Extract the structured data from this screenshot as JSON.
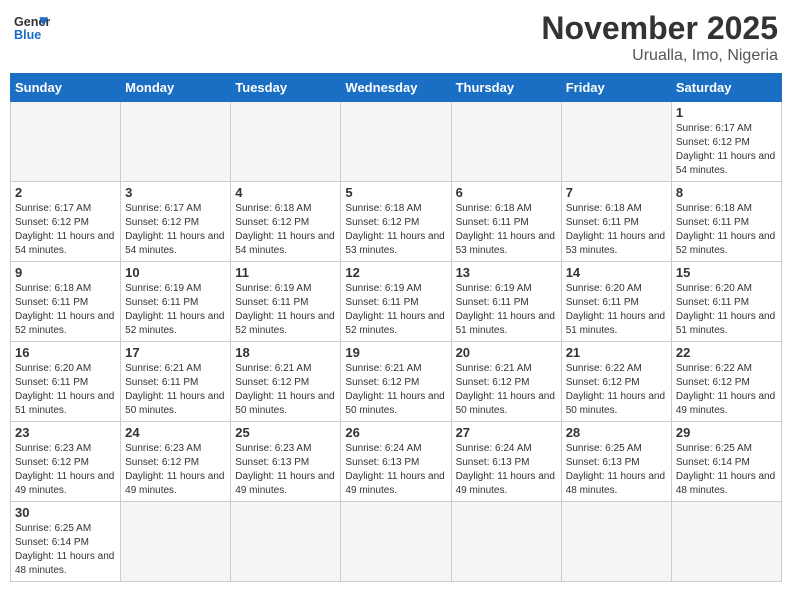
{
  "header": {
    "logo_general": "General",
    "logo_blue": "Blue",
    "month_title": "November 2025",
    "location": "Urualla, Imo, Nigeria"
  },
  "weekdays": [
    "Sunday",
    "Monday",
    "Tuesday",
    "Wednesday",
    "Thursday",
    "Friday",
    "Saturday"
  ],
  "weeks": [
    [
      {
        "day": "",
        "empty": true
      },
      {
        "day": "",
        "empty": true
      },
      {
        "day": "",
        "empty": true
      },
      {
        "day": "",
        "empty": true
      },
      {
        "day": "",
        "empty": true
      },
      {
        "day": "",
        "empty": true
      },
      {
        "day": "1",
        "sunrise": "6:17 AM",
        "sunset": "6:12 PM",
        "daylight": "11 hours and 54 minutes."
      }
    ],
    [
      {
        "day": "2",
        "sunrise": "6:17 AM",
        "sunset": "6:12 PM",
        "daylight": "11 hours and 54 minutes."
      },
      {
        "day": "3",
        "sunrise": "6:17 AM",
        "sunset": "6:12 PM",
        "daylight": "11 hours and 54 minutes."
      },
      {
        "day": "4",
        "sunrise": "6:18 AM",
        "sunset": "6:12 PM",
        "daylight": "11 hours and 54 minutes."
      },
      {
        "day": "5",
        "sunrise": "6:18 AM",
        "sunset": "6:12 PM",
        "daylight": "11 hours and 53 minutes."
      },
      {
        "day": "6",
        "sunrise": "6:18 AM",
        "sunset": "6:11 PM",
        "daylight": "11 hours and 53 minutes."
      },
      {
        "day": "7",
        "sunrise": "6:18 AM",
        "sunset": "6:11 PM",
        "daylight": "11 hours and 53 minutes."
      },
      {
        "day": "8",
        "sunrise": "6:18 AM",
        "sunset": "6:11 PM",
        "daylight": "11 hours and 52 minutes."
      }
    ],
    [
      {
        "day": "9",
        "sunrise": "6:18 AM",
        "sunset": "6:11 PM",
        "daylight": "11 hours and 52 minutes."
      },
      {
        "day": "10",
        "sunrise": "6:19 AM",
        "sunset": "6:11 PM",
        "daylight": "11 hours and 52 minutes."
      },
      {
        "day": "11",
        "sunrise": "6:19 AM",
        "sunset": "6:11 PM",
        "daylight": "11 hours and 52 minutes."
      },
      {
        "day": "12",
        "sunrise": "6:19 AM",
        "sunset": "6:11 PM",
        "daylight": "11 hours and 52 minutes."
      },
      {
        "day": "13",
        "sunrise": "6:19 AM",
        "sunset": "6:11 PM",
        "daylight": "11 hours and 51 minutes."
      },
      {
        "day": "14",
        "sunrise": "6:20 AM",
        "sunset": "6:11 PM",
        "daylight": "11 hours and 51 minutes."
      },
      {
        "day": "15",
        "sunrise": "6:20 AM",
        "sunset": "6:11 PM",
        "daylight": "11 hours and 51 minutes."
      }
    ],
    [
      {
        "day": "16",
        "sunrise": "6:20 AM",
        "sunset": "6:11 PM",
        "daylight": "11 hours and 51 minutes."
      },
      {
        "day": "17",
        "sunrise": "6:21 AM",
        "sunset": "6:11 PM",
        "daylight": "11 hours and 50 minutes."
      },
      {
        "day": "18",
        "sunrise": "6:21 AM",
        "sunset": "6:12 PM",
        "daylight": "11 hours and 50 minutes."
      },
      {
        "day": "19",
        "sunrise": "6:21 AM",
        "sunset": "6:12 PM",
        "daylight": "11 hours and 50 minutes."
      },
      {
        "day": "20",
        "sunrise": "6:21 AM",
        "sunset": "6:12 PM",
        "daylight": "11 hours and 50 minutes."
      },
      {
        "day": "21",
        "sunrise": "6:22 AM",
        "sunset": "6:12 PM",
        "daylight": "11 hours and 50 minutes."
      },
      {
        "day": "22",
        "sunrise": "6:22 AM",
        "sunset": "6:12 PM",
        "daylight": "11 hours and 49 minutes."
      }
    ],
    [
      {
        "day": "23",
        "sunrise": "6:23 AM",
        "sunset": "6:12 PM",
        "daylight": "11 hours and 49 minutes."
      },
      {
        "day": "24",
        "sunrise": "6:23 AM",
        "sunset": "6:12 PM",
        "daylight": "11 hours and 49 minutes."
      },
      {
        "day": "25",
        "sunrise": "6:23 AM",
        "sunset": "6:13 PM",
        "daylight": "11 hours and 49 minutes."
      },
      {
        "day": "26",
        "sunrise": "6:24 AM",
        "sunset": "6:13 PM",
        "daylight": "11 hours and 49 minutes."
      },
      {
        "day": "27",
        "sunrise": "6:24 AM",
        "sunset": "6:13 PM",
        "daylight": "11 hours and 49 minutes."
      },
      {
        "day": "28",
        "sunrise": "6:25 AM",
        "sunset": "6:13 PM",
        "daylight": "11 hours and 48 minutes."
      },
      {
        "day": "29",
        "sunrise": "6:25 AM",
        "sunset": "6:14 PM",
        "daylight": "11 hours and 48 minutes."
      }
    ],
    [
      {
        "day": "30",
        "sunrise": "6:25 AM",
        "sunset": "6:14 PM",
        "daylight": "11 hours and 48 minutes."
      },
      {
        "day": "",
        "empty": true
      },
      {
        "day": "",
        "empty": true
      },
      {
        "day": "",
        "empty": true
      },
      {
        "day": "",
        "empty": true
      },
      {
        "day": "",
        "empty": true
      },
      {
        "day": "",
        "empty": true
      }
    ]
  ],
  "labels": {
    "sunrise": "Sunrise:",
    "sunset": "Sunset:",
    "daylight": "Daylight:"
  }
}
